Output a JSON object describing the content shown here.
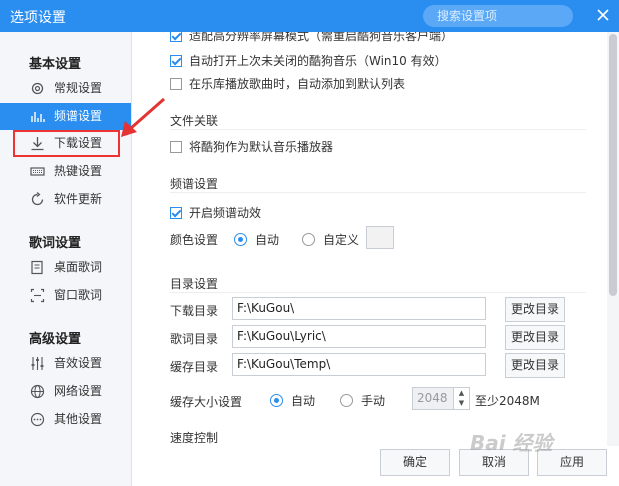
{
  "window": {
    "title": "选项设置",
    "search_placeholder": "搜索设置项"
  },
  "sidebar": {
    "groups": [
      {
        "label": "基本设置"
      },
      {
        "label": "歌词设置"
      },
      {
        "label": "高级设置"
      }
    ],
    "items": [
      {
        "label": "常规设置",
        "icon": "gear-icon"
      },
      {
        "label": "频谱设置",
        "icon": "spectrum-icon"
      },
      {
        "label": "下载设置",
        "icon": "download-icon"
      },
      {
        "label": "热键设置",
        "icon": "keyboard-icon"
      },
      {
        "label": "软件更新",
        "icon": "update-icon"
      },
      {
        "label": "桌面歌词",
        "icon": "desktop-lyrics-icon"
      },
      {
        "label": "窗口歌词",
        "icon": "window-lyrics-icon"
      },
      {
        "label": "音效设置",
        "icon": "equalizer-icon"
      },
      {
        "label": "网络设置",
        "icon": "globe-icon"
      },
      {
        "label": "其他设置",
        "icon": "more-icon"
      }
    ],
    "active_item": "频谱设置",
    "highlighted_item": "下载设置"
  },
  "content": {
    "partial_top_text": "适配高分辨率屏幕模式（需重启酷狗音乐客户端）",
    "auto_open_label": "自动打开上次未关闭的酷狗音乐（Win10 有效）",
    "auto_open_checked": true,
    "auto_add_label": "在乐库播放歌曲时，自动添加到默认列表",
    "auto_add_checked": false,
    "file_assoc": {
      "title": "文件关联",
      "default_player_label": "将酷狗作为默认音乐播放器",
      "checked": false
    },
    "spectrum": {
      "title": "频谱设置",
      "enable_label": "开启频谱动效",
      "enable_checked": true,
      "color_label": "颜色设置",
      "auto_label": "自动",
      "custom_label": "自定义",
      "selected": "自动"
    },
    "directory": {
      "title": "目录设置",
      "rows": [
        {
          "label": "下载目录",
          "value": "F:\\KuGou\\",
          "button": "更改目录"
        },
        {
          "label": "歌词目录",
          "value": "F:\\KuGou\\Lyric\\",
          "button": "更改目录"
        },
        {
          "label": "缓存目录",
          "value": "F:\\KuGou\\Temp\\",
          "button": "更改目录"
        }
      ],
      "cache_size_label": "缓存大小设置",
      "cache_auto_label": "自动",
      "cache_manual_label": "手动",
      "cache_selected": "自动",
      "cache_value": "2048",
      "cache_min_label": "至少2048M"
    },
    "partial_bottom_text": "速度控制"
  },
  "footer": {
    "ok_label": "确定",
    "cancel_label": "取消",
    "apply_label": "应用"
  },
  "watermark": "Bai 经验",
  "colors": {
    "accent": "#2a8df0",
    "highlight_border": "#e33333"
  }
}
